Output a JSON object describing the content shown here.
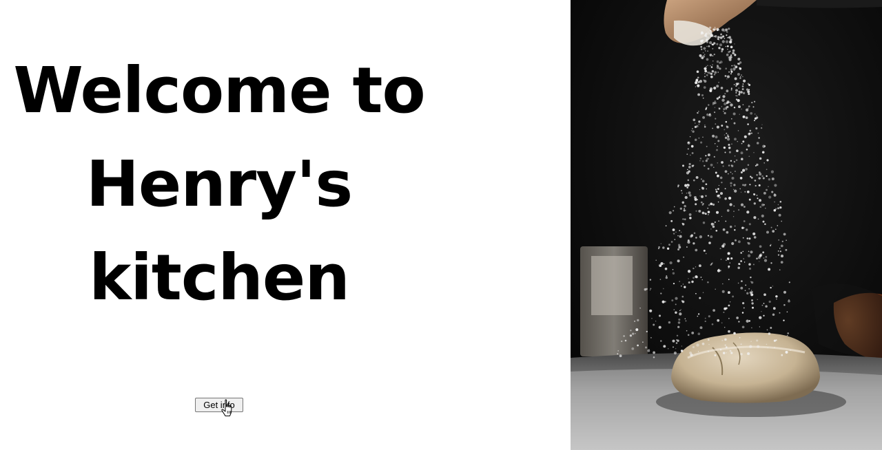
{
  "hero": {
    "title_lines": [
      "Welcome to",
      "Henry's",
      "kitchen"
    ]
  },
  "actions": {
    "get_info_label": "Get info"
  },
  "photo": {
    "subject": "flour-dusting-dough-photo",
    "colors": {
      "background": "#0a0a0a",
      "flour": "#f2f2f2",
      "dough": "#c9b89a",
      "bowl": "#a0522d"
    }
  },
  "colors": {
    "page_background": "#ffffff",
    "title_text": "#000000",
    "button_background": "#efefef",
    "button_border": "#767676"
  }
}
